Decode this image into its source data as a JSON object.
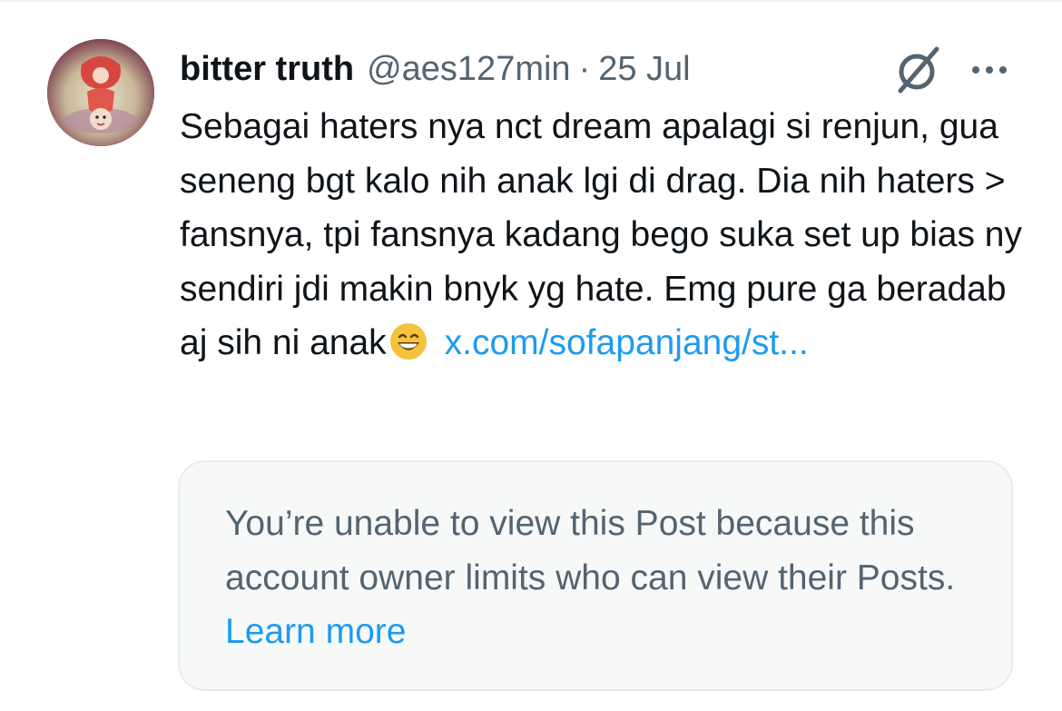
{
  "tweet": {
    "author_name": "bitter truth",
    "handle": "@aes127",
    "time_ago": "min",
    "separator": "·",
    "date": "25 Jul",
    "text": "Sebagai haters nya nct dream apalagi si renjun, gua seneng bgt kalo nih anak lgi di drag. Dia nih haters > fansnya, tpi fansnya kadang bego suka set up bias ny sendiri jdi makin bnyk yg hate. Emg pure ga beradab aj sih ni anak",
    "emoji": "grinning-face-with-smiling-eyes",
    "link_text": "x.com/sofapanjang/st..."
  },
  "quoted_post": {
    "message": "You’re unable to view this Post because this account owner limits who can view their Posts.",
    "learn_more_label": "Learn more"
  },
  "icons": {
    "grok": "grok-icon",
    "more": "more-options-icon"
  },
  "colors": {
    "text_primary": "#0f1419",
    "text_secondary": "#536471",
    "link": "#1d9bf0",
    "card_background": "#f7f9f9",
    "card_border": "#e7ecef"
  }
}
